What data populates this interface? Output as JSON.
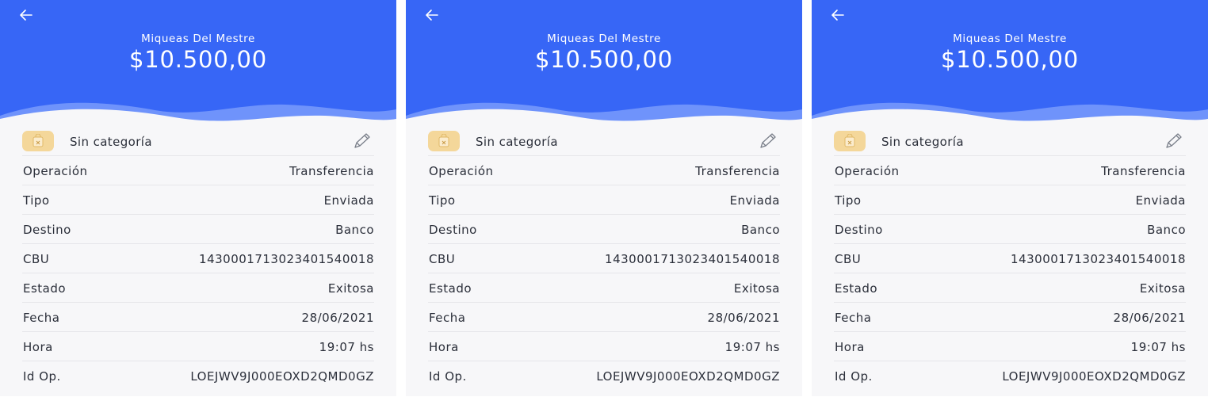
{
  "screens": [
    {
      "header": {
        "name": "Miqueas Del Mestre",
        "amount": "$10.500,00"
      },
      "category": {
        "label": "Sin categoría"
      },
      "details": [
        {
          "key": "Operación",
          "value": "Transferencia"
        },
        {
          "key": "Tipo",
          "value": "Enviada"
        },
        {
          "key": "Destino",
          "value": "Banco"
        },
        {
          "key": "CBU",
          "value": "1430001713023401540018"
        },
        {
          "key": "Estado",
          "value": "Exitosa"
        },
        {
          "key": "Fecha",
          "value": "28/06/2021"
        },
        {
          "key": "Hora",
          "value": "19:07 hs"
        },
        {
          "key": "Id Op.",
          "value": "LOEJWV9J000EOXD2QMD0GZ"
        }
      ]
    },
    {
      "header": {
        "name": "Miqueas Del Mestre",
        "amount": "$10.500,00"
      },
      "category": {
        "label": "Sin categoría"
      },
      "details": [
        {
          "key": "Operación",
          "value": "Transferencia"
        },
        {
          "key": "Tipo",
          "value": "Enviada"
        },
        {
          "key": "Destino",
          "value": "Banco"
        },
        {
          "key": "CBU",
          "value": "1430001713023401540018"
        },
        {
          "key": "Estado",
          "value": "Exitosa"
        },
        {
          "key": "Fecha",
          "value": "28/06/2021"
        },
        {
          "key": "Hora",
          "value": "19:07 hs"
        },
        {
          "key": "Id Op.",
          "value": "LOEJWV9J000EOXD2QMD0GZ"
        }
      ]
    },
    {
      "header": {
        "name": "Miqueas Del Mestre",
        "amount": "$10.500,00"
      },
      "category": {
        "label": "Sin categoría"
      },
      "details": [
        {
          "key": "Operación",
          "value": "Transferencia"
        },
        {
          "key": "Tipo",
          "value": "Enviada"
        },
        {
          "key": "Destino",
          "value": "Banco"
        },
        {
          "key": "CBU",
          "value": "1430001713023401540018"
        },
        {
          "key": "Estado",
          "value": "Exitosa"
        },
        {
          "key": "Fecha",
          "value": "28/06/2021"
        },
        {
          "key": "Hora",
          "value": "19:07 hs"
        },
        {
          "key": "Id Op.",
          "value": "LOEJWV9J000EOXD2QMD0GZ"
        }
      ]
    }
  ],
  "icons": {
    "back": "arrow-left-icon",
    "category": "category-bag-icon",
    "edit": "pencil-icon"
  },
  "colors": {
    "header": "#3766f6",
    "wave_light": "#6f93fb",
    "category_bg": "#f4d79a",
    "panel_bg": "#f7f7f9"
  }
}
